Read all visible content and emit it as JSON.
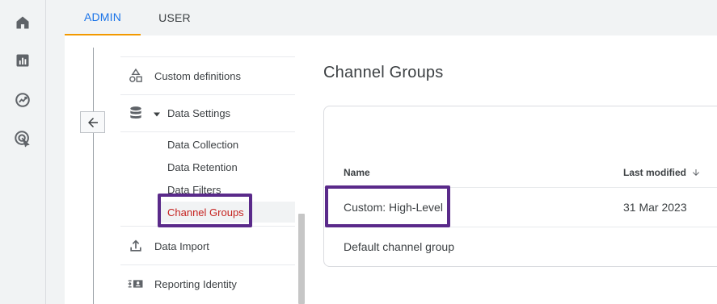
{
  "tabs": [
    {
      "label": "ADMIN",
      "active": true
    },
    {
      "label": "USER",
      "active": false
    }
  ],
  "leftnav": {
    "icons": [
      "home-icon",
      "reports-icon",
      "explore-icon",
      "advertising-icon"
    ]
  },
  "menu": {
    "custom_definitions": "Custom definitions",
    "data_settings": "Data Settings",
    "sub_items": [
      "Data Collection",
      "Data Retention",
      "Data Filters",
      "Channel Groups"
    ],
    "data_import": "Data Import",
    "reporting_identity": "Reporting Identity"
  },
  "page": {
    "title": "Channel Groups"
  },
  "table": {
    "columns": {
      "name": "Name",
      "last_modified": "Last modified"
    },
    "rows": [
      {
        "name": "Custom: High-Level",
        "last_modified": "31 Mar 2023"
      },
      {
        "name": "Default channel group",
        "last_modified": ""
      }
    ]
  },
  "colors": {
    "accent": "#1a73e8",
    "tab_underline": "#f29900",
    "active_item": "#c5221f",
    "highlight_box": "#5a2a8a"
  }
}
